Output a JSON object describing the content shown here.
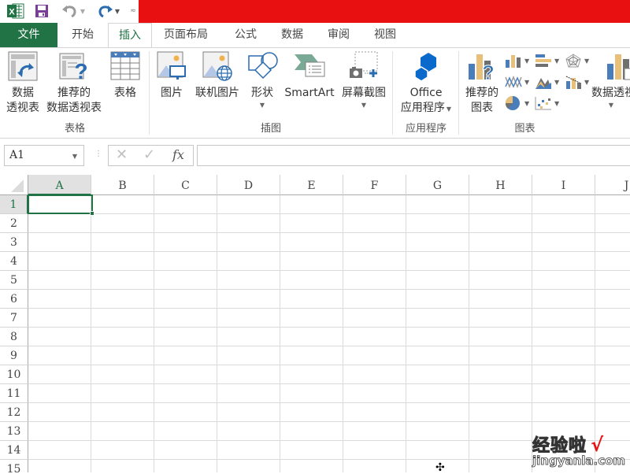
{
  "titlebar": {
    "app_icon": "excel-icon",
    "qat": [
      {
        "name": "save",
        "icon": "save-icon"
      },
      {
        "name": "undo",
        "icon": "undo-icon"
      },
      {
        "name": "redo",
        "icon": "redo-icon"
      },
      {
        "name": "customize",
        "icon": "customize-qat-icon"
      }
    ],
    "accent_color": "#e81010"
  },
  "tabs": [
    {
      "label": "文件",
      "type": "file"
    },
    {
      "label": "开始"
    },
    {
      "label": "插入",
      "active": true
    },
    {
      "label": "页面布局"
    },
    {
      "label": "公式"
    },
    {
      "label": "数据"
    },
    {
      "label": "审阅"
    },
    {
      "label": "视图"
    }
  ],
  "ribbon": {
    "groups": {
      "tables": {
        "label": "表格",
        "buttons": [
          {
            "line1": "数据",
            "line2": "透视表",
            "icon": "pivot-table-icon"
          },
          {
            "line1": "推荐的",
            "line2": "数据透视表",
            "icon": "recommended-pivot-table-icon"
          },
          {
            "line1": "表格",
            "line2": "",
            "icon": "table-icon"
          }
        ]
      },
      "illustrations": {
        "label": "插图",
        "buttons": [
          {
            "line1": "图片",
            "icon": "picture-icon"
          },
          {
            "line1": "联机图片",
            "icon": "online-picture-icon"
          },
          {
            "line1": "形状",
            "icon": "shapes-icon",
            "dropdown": true
          },
          {
            "line1": "SmartArt",
            "icon": "smartart-icon"
          },
          {
            "line1": "屏幕截图",
            "icon": "screenshot-icon",
            "dropdown": true
          }
        ]
      },
      "apps": {
        "label": "应用程序",
        "buttons": [
          {
            "line1": "Office",
            "line2": "应用程序",
            "icon": "office-apps-icon",
            "dropdown": true
          }
        ]
      },
      "charts": {
        "label": "图表",
        "buttons": [
          {
            "line1": "推荐的",
            "line2": "图表",
            "icon": "recommended-charts-icon"
          },
          {
            "line1": "数据透视",
            "line2": "",
            "icon": "pivot-chart-icon"
          }
        ],
        "small_icons": [
          "column-chart-icon",
          "bar-chart-icon",
          "radar-chart-icon",
          "line-chart-icon",
          "area-chart-icon",
          "combo-chart-icon",
          "pie-chart-icon",
          "scatter-chart-icon"
        ]
      }
    }
  },
  "formula_bar": {
    "name_box": "A1",
    "cancel_icon": "✕",
    "enter_icon": "✓",
    "fx_label": "fx",
    "value": ""
  },
  "sheet": {
    "columns": [
      "A",
      "B",
      "C",
      "D",
      "E",
      "F",
      "G",
      "H",
      "I",
      "J"
    ],
    "rows": [
      "1",
      "2",
      "3",
      "4",
      "5",
      "6",
      "7",
      "8",
      "9",
      "10",
      "11",
      "12",
      "13",
      "14",
      "15"
    ],
    "selected_cell": "A1",
    "selection_color": "#217346"
  },
  "watermark": {
    "cn": "经验啦",
    "check": "√",
    "en": "jingyanla.com"
  }
}
